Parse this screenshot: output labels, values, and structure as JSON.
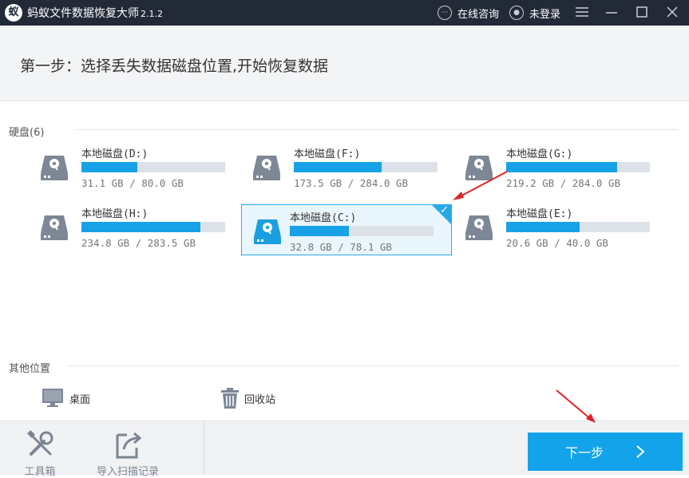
{
  "app": {
    "title": "蚂蚁文件数据恢复大师",
    "version": "2.1.2",
    "logo_icon": "ant-logo-icon"
  },
  "titlebar": {
    "consult_label": "在线咨询",
    "login_label": "未登录"
  },
  "header": {
    "step_title": "第一步：选择丢失数据磁盘位置,开始恢复数据"
  },
  "disks_section": {
    "label": "硬盘(6)"
  },
  "drives": [
    {
      "name": "本地磁盘(D:)",
      "size_text": "31.1 GB / 80.0 GB",
      "used_fraction": 0.39,
      "selected": false
    },
    {
      "name": "本地磁盘(F:)",
      "size_text": "173.5 GB / 284.0 GB",
      "used_fraction": 0.61,
      "selected": false
    },
    {
      "name": "本地磁盘(G:)",
      "size_text": "219.2 GB / 284.0 GB",
      "used_fraction": 0.77,
      "selected": false
    },
    {
      "name": "本地磁盘(H:)",
      "size_text": "234.8 GB / 283.5 GB",
      "used_fraction": 0.83,
      "selected": false
    },
    {
      "name": "本地磁盘(C:)",
      "size_text": "32.8 GB / 78.1 GB",
      "used_fraction": 0.41,
      "selected": true
    },
    {
      "name": "本地磁盘(E:)",
      "size_text": "20.6 GB / 40.0 GB",
      "used_fraction": 0.51,
      "selected": false
    }
  ],
  "other_section": {
    "label": "其他位置",
    "items": [
      {
        "label": "桌面",
        "icon": "desktop-monitor-icon"
      },
      {
        "label": "回收站",
        "icon": "recycle-bin-icon"
      }
    ]
  },
  "footer": {
    "toolbox_label": "工具箱",
    "import_label": "导入扫描记录",
    "next_label": "下一步"
  },
  "colors": {
    "titlebar": "#232a37",
    "accent": "#13a3ea",
    "bar_track": "#dde2e8",
    "selected_bg": "#eaf6fd",
    "arrow": "#e02424"
  }
}
